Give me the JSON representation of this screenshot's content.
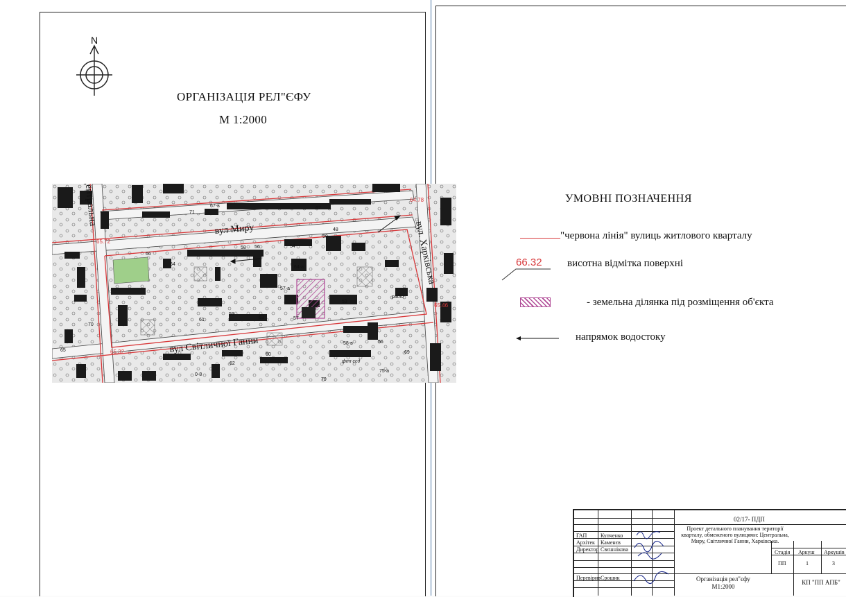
{
  "left_sheet": {
    "title": "ОРГАНІЗАЦІЯ РЕЛ\"ЄФУ",
    "scale": "М 1:2000",
    "north_label": "N"
  },
  "map": {
    "street_labels": {
      "tsentralna": "вул. Центральна",
      "myru": "вул Миру",
      "svitlychnoi": "вул Світличної Ганни",
      "kharkivska": "вул. Харківська"
    },
    "elevations": [
      "64.78",
      "65.72",
      "65.46",
      "65.32"
    ],
    "house_numbers": [
      "71",
      "67-в",
      "67",
      "66",
      "64",
      "58",
      "56",
      "54",
      "50",
      "48",
      "64-а",
      "57-а",
      "53",
      "57",
      "61",
      "59",
      "63",
      "65",
      "70",
      "60",
      "62",
      "58-в",
      "56",
      "69",
      "75-а",
      "79",
      "0-8"
    ],
    "small_labels": [
      "радіо",
      "фпп ссд"
    ]
  },
  "legend": {
    "title": "УМОВНІ ПОЗНАЧЕННЯ",
    "red_line_label": "\"червона лінія\" вулиць житлового кварталу",
    "elevation_sample": "66.32",
    "elevation_label": "висотна  відмітка поверхні",
    "parcel_label": "- земельна ділянка під розміщення об'єкта",
    "drain_label": "напрямок водостоку"
  },
  "colors": {
    "red_line": "#d8383a",
    "parcel": "#b04a96",
    "green_area": "#9fcf8a",
    "building": "#1a1a1a"
  },
  "stamp": {
    "code": "02/17- ПДП",
    "project_desc": "Проект детального планування території кварталу, обмеженого вулицями: Центральна,  Миру, Світличної Ганни, Харківська.",
    "roles": [
      {
        "role": "ГАП",
        "name": "Купченко"
      },
      {
        "role": "Архітек",
        "name": "Каменєв"
      },
      {
        "role": "Директор",
        "name": "Свєшнікова"
      },
      {
        "role": "Перевірив",
        "name": "Срошик"
      }
    ],
    "headers": [
      "Стадія",
      "Аркуш",
      "Аркушів"
    ],
    "values": [
      "ПП",
      "1",
      "3"
    ],
    "sheet_title": "Організація рел\"єфу",
    "sheet_scale": "М1:2000",
    "org": "КП \"ПП АПБ\""
  }
}
